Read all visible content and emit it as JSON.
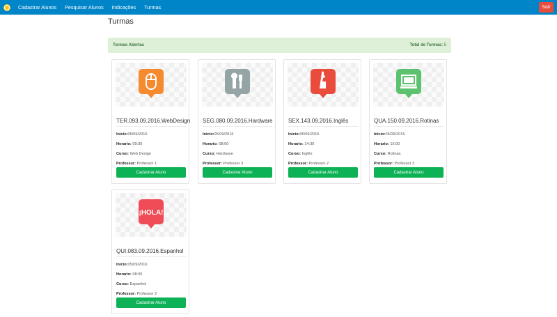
{
  "nav": {
    "links": [
      "Cadastrar Alunos",
      "Pesquisar Alunos",
      "Indicações",
      "Turmas"
    ],
    "logout_label": "Sair"
  },
  "page_title": "Turmas",
  "alert": {
    "left": "Turmas Abertas",
    "total_label": "Total de Turmas:",
    "total_value": "5"
  },
  "labels": {
    "inicio": "Inicio:",
    "horario": "Horario:",
    "curso": "Curso:",
    "professor": "Professor:",
    "button": "Cadastrar Aluno"
  },
  "cards": [
    {
      "title": "TER.093.09.2016.WebDesign",
      "inicio": "05/09/2016",
      "horario": "09:30",
      "curso": "Web Design",
      "professor": "Professor 1",
      "icon": "mouse-icon",
      "color": "#f58a2e"
    },
    {
      "title": "SEG.080.09.2016.Hardware",
      "inicio": "05/09/2016",
      "horario": "08:00",
      "curso": "Hardware",
      "professor": "Professor 3",
      "icon": "tools-icon",
      "color": "#95a5a6"
    },
    {
      "title": "SEX.143.09.2016.Inglês",
      "inicio": "05/09/2016",
      "horario": "14:30",
      "curso": "Inglês",
      "professor": "Professor 2",
      "icon": "statue-of-liberty-icon",
      "color": "#ea4c3b"
    },
    {
      "title": "QUA.150.09.2016.Rotinas",
      "inicio": "05/09/2016",
      "horario": "15:00",
      "curso": "Rotinas",
      "professor": "Professor 3",
      "icon": "computer-icon",
      "color": "#5cc26f"
    },
    {
      "title": "QUI.083.09.2016.Espanhol",
      "inicio": "05/09/2016",
      "horario": "08:30",
      "curso": "Espanhol",
      "professor": "Professor 2",
      "icon": "hola-icon",
      "color": "#ef4c57",
      "icon_text": "¡HOLA!"
    }
  ]
}
